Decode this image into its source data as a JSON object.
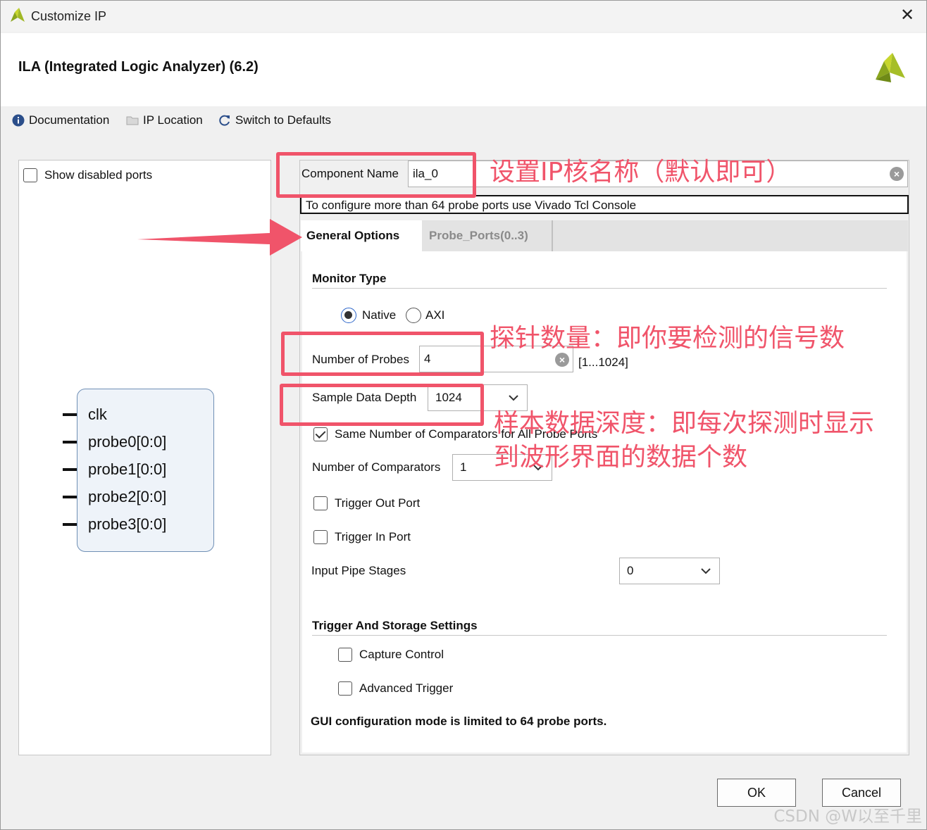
{
  "window": {
    "title": "Customize IP",
    "ip_title": "ILA (Integrated Logic Analyzer) (6.2)"
  },
  "toolbar": {
    "documentation": "Documentation",
    "ip_location": "IP Location",
    "switch_defaults": "Switch to Defaults"
  },
  "left": {
    "show_disabled_ports": "Show disabled ports",
    "ports": [
      "clk",
      "probe0[0:0]",
      "probe1[0:0]",
      "probe2[0:0]",
      "probe3[0:0]"
    ]
  },
  "component": {
    "label": "Component Name",
    "value": "ila_0",
    "info": "To configure more than 64 probe ports use Vivado Tcl Console"
  },
  "tabs": {
    "general": "General Options",
    "probe_ports": "Probe_Ports(0..3)"
  },
  "general": {
    "monitor_type_title": "Monitor Type",
    "native_label": "Native",
    "axi_label": "AXI",
    "monitor_selected": "Native",
    "num_probes_label": "Number of Probes",
    "num_probes_value": "4",
    "num_probes_range": "[1...1024]",
    "sample_depth_label": "Sample Data Depth",
    "sample_depth_value": "1024",
    "same_comparators_label": "Same Number of Comparators for All Probe Ports",
    "same_comparators_checked": true,
    "num_comparators_label": "Number of Comparators",
    "num_comparators_value": "1",
    "trigger_out_label": "Trigger Out Port",
    "trigger_in_label": "Trigger In Port",
    "input_pipe_label": "Input Pipe Stages",
    "input_pipe_value": "0",
    "trigger_storage_title": "Trigger And Storage Settings",
    "capture_control_label": "Capture Control",
    "advanced_trigger_label": "Advanced Trigger",
    "gui_note": "GUI configuration mode is limited to 64 probe ports."
  },
  "buttons": {
    "ok": "OK",
    "cancel": "Cancel"
  },
  "annotations": {
    "name_note": "设置IP核名称（默认即可）",
    "probes_note": "探针数量：即你要检测的信号数",
    "depth_note_1": "样本数据深度：即每次探测时显示",
    "depth_note_2": "到波形界面的数据个数"
  },
  "watermark": "CSDN @W以至千里",
  "colors": {
    "annotation": "#f0546a",
    "symbol_border": "#6f8fb5",
    "symbol_fill": "#eef3f9"
  }
}
